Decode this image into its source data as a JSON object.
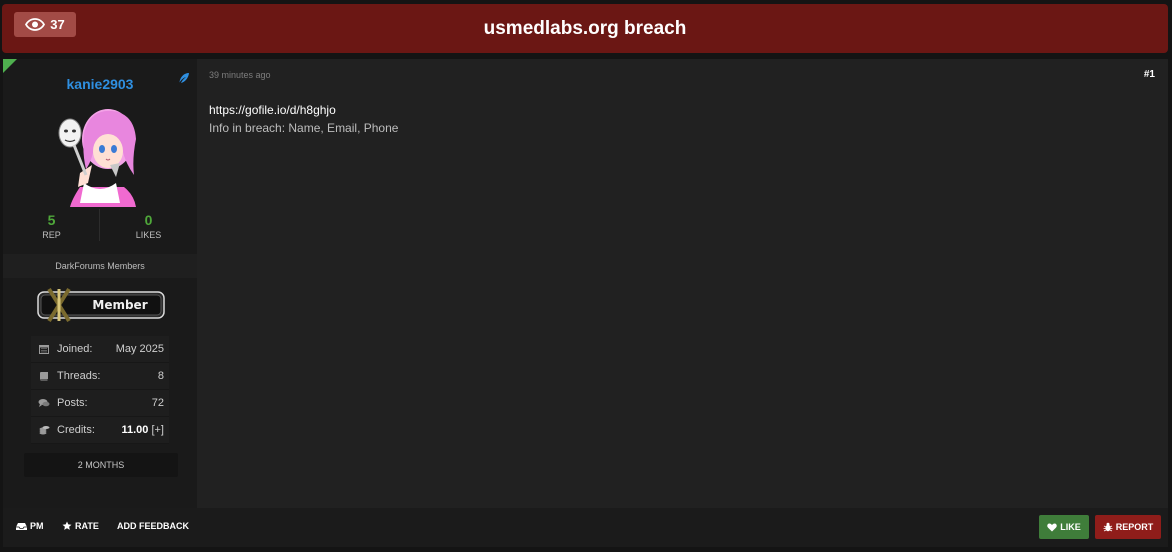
{
  "header": {
    "view_count": "37",
    "title": "usmedlabs.org breach"
  },
  "author": {
    "username": "kanie2903",
    "reputation": "5",
    "reputation_label": "REP",
    "likes": "0",
    "likes_label": "LIKES",
    "usergroup": "DarkForums Members",
    "rank_label": "Member",
    "info": [
      {
        "icon": "calendar-icon",
        "label": "Joined:",
        "value": "May 2025"
      },
      {
        "icon": "book-icon",
        "label": "Threads:",
        "value": "8"
      },
      {
        "icon": "comments-icon",
        "label": "Posts:",
        "value": "72"
      },
      {
        "icon": "coins-icon",
        "label": "Credits:",
        "value": "11.00",
        "extra": "[+]"
      }
    ],
    "membership_duration": "2 MONTHS"
  },
  "post": {
    "timestamp": "39 minutes ago",
    "number": "#1",
    "link": "https://gofile.io/d/h8ghjo",
    "body": "Info in breach: Name, Email, Phone"
  },
  "footer": {
    "pm_label": "PM",
    "rate_label": "RATE",
    "feedback_label": "ADD FEEDBACK",
    "like_label": "LIKE",
    "report_label": "REPORT"
  },
  "colors": {
    "title_bar": "#6b1714",
    "username": "#2f8fe0",
    "stat_number": "#4fa83a",
    "like_button": "#3f7d3a",
    "report_button": "#8f1d1a"
  }
}
